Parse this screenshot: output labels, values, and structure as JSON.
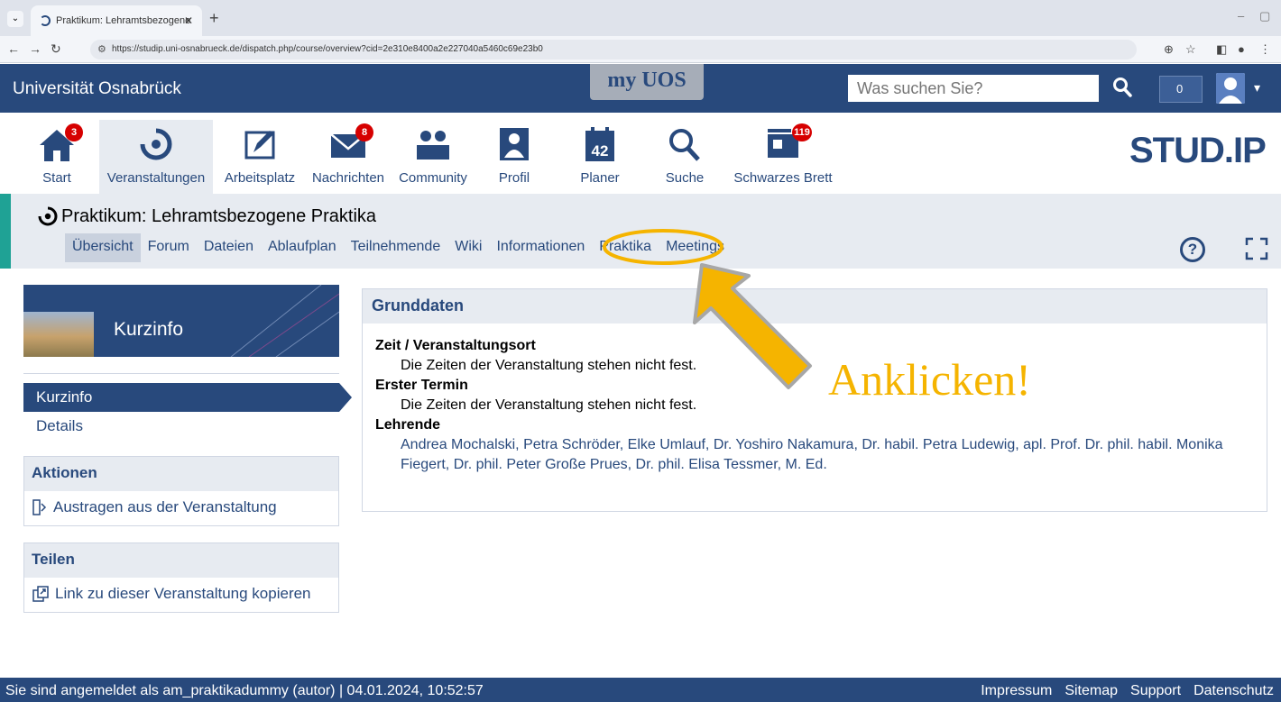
{
  "browser": {
    "tab_title": "Praktikum: Lehramtsbezogene",
    "url": "https://studip.uni-osnabrueck.de/dispatch.php/course/overview?cid=2e310e8400a2e227040a5460c69e23b0"
  },
  "topbar": {
    "university": "Universität Osnabrück",
    "logo": "my UOS",
    "search_placeholder": "Was suchen Sie?",
    "counter": "0"
  },
  "mainnav": {
    "items": [
      {
        "label": "Start",
        "badge": "3",
        "icon": "home-icon"
      },
      {
        "label": "Veranstaltungen",
        "badge": "",
        "icon": "seminar-icon"
      },
      {
        "label": "Arbeitsplatz",
        "badge": "",
        "icon": "workplace-icon"
      },
      {
        "label": "Nachrichten",
        "badge": "8",
        "icon": "mail-icon"
      },
      {
        "label": "Community",
        "badge": "",
        "icon": "community-icon"
      },
      {
        "label": "Profil",
        "badge": "",
        "icon": "profile-icon"
      },
      {
        "label": "Planer",
        "badge": "",
        "icon": "calendar-icon",
        "day": "42"
      },
      {
        "label": "Suche",
        "badge": "",
        "icon": "search-icon"
      },
      {
        "label": "Schwarzes Brett",
        "badge": "119",
        "icon": "board-icon"
      }
    ],
    "brand": "STUD.IP"
  },
  "course": {
    "title": "Praktikum: Lehramtsbezogene Praktika",
    "tabs": [
      "Übersicht",
      "Forum",
      "Dateien",
      "Ablaufplan",
      "Teilnehmende",
      "Wiki",
      "Informationen",
      "Praktika",
      "Meetings"
    ],
    "active_tab": "Übersicht"
  },
  "sidebar": {
    "image_title": "Kurzinfo",
    "nav": [
      {
        "label": "Kurzinfo",
        "active": true
      },
      {
        "label": "Details",
        "active": false
      }
    ],
    "actions_title": "Aktionen",
    "actions": [
      {
        "label": "Austragen aus der Veranstaltung",
        "icon": "exit-icon"
      }
    ],
    "share_title": "Teilen",
    "share": [
      {
        "label": "Link zu dieser Veranstaltung kopieren",
        "icon": "copy-link-icon"
      }
    ]
  },
  "content": {
    "box_title": "Grunddaten",
    "sections": [
      {
        "term": "Zeit / Veranstaltungsort",
        "value": "Die Zeiten der Veranstaltung stehen nicht fest."
      },
      {
        "term": "Erster Termin",
        "value": "Die Zeiten der Veranstaltung stehen nicht fest."
      },
      {
        "term": "Lehrende",
        "value": "Andrea Mochalski, Petra Schröder, Elke Umlauf, Dr. Yoshiro Nakamura, Dr. habil. Petra Ludewig, apl. Prof. Dr. phil. habil. Monika Fiegert, Dr. phil. Peter Große Prues, Dr. phil. Elisa Tessmer, M. Ed."
      }
    ]
  },
  "annotation": {
    "text": "Anklicken!",
    "color": "#f5b400"
  },
  "footer": {
    "status": "Sie sind angemeldet als am_praktikadummy (autor) | 04.01.2024, 10:52:57",
    "links": [
      "Impressum",
      "Sitemap",
      "Support",
      "Datenschutz"
    ]
  },
  "colors": {
    "brand_blue": "#28497c",
    "course_accent": "#1fa295",
    "badge_red": "#d60000"
  }
}
